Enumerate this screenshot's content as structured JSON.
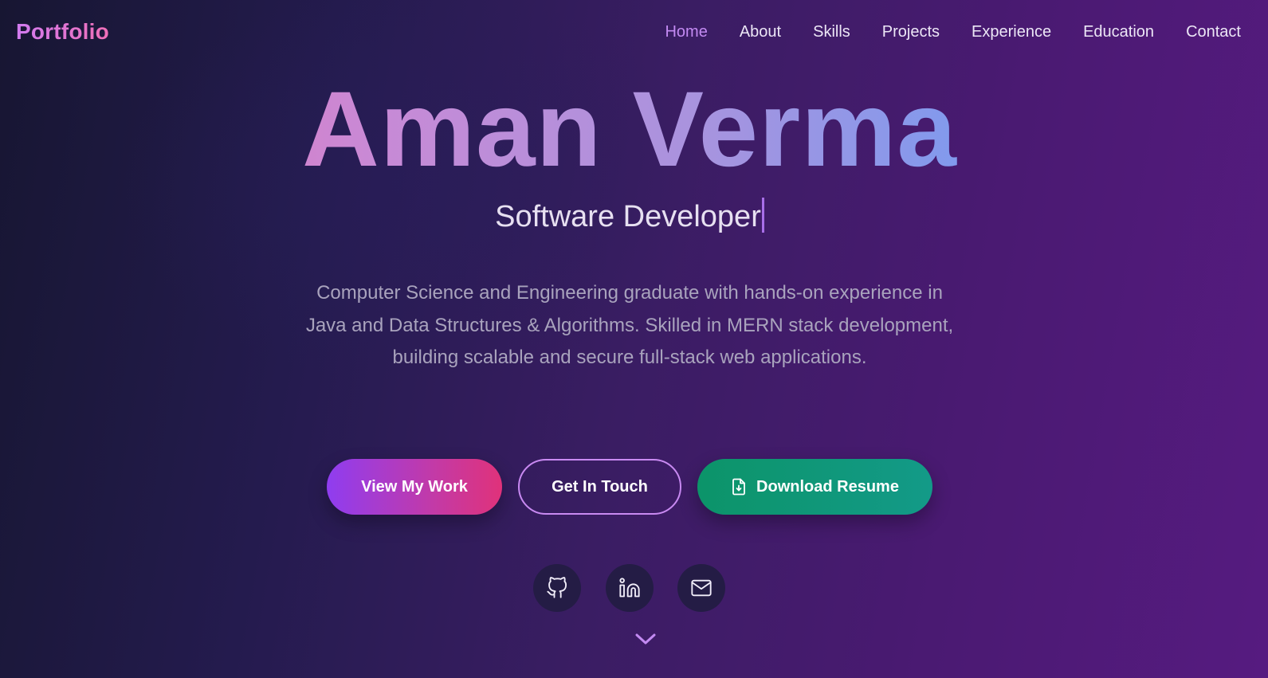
{
  "nav": {
    "logo": "Portfolio",
    "links": [
      {
        "label": "Home",
        "active": true
      },
      {
        "label": "About"
      },
      {
        "label": "Skills"
      },
      {
        "label": "Projects"
      },
      {
        "label": "Experience"
      },
      {
        "label": "Education"
      },
      {
        "label": "Contact"
      }
    ]
  },
  "hero": {
    "name": "Aman Verma",
    "role": "Software Developer",
    "description": "Computer Science and Engineering graduate with hands-on experience in Java and Data Structures & Algorithms. Skilled in MERN stack development, building scalable and secure full-stack web applications."
  },
  "buttons": {
    "view_work": "View My Work",
    "get_in_touch": "Get In Touch",
    "download_resume": "Download Resume",
    "download_icon": "file-download-icon"
  },
  "social": {
    "icons": [
      "github-icon",
      "linkedin-icon",
      "mail-icon"
    ]
  },
  "scroll": {
    "icon": "chevron-down-icon"
  },
  "colors": {
    "accent": "#c38af2",
    "gradient_start": "#ec6eb5",
    "gradient_end": "#5e9cf6",
    "resume_green": "#0c9469",
    "work_purple": "#8f3df0",
    "work_pink": "#e0327a"
  }
}
